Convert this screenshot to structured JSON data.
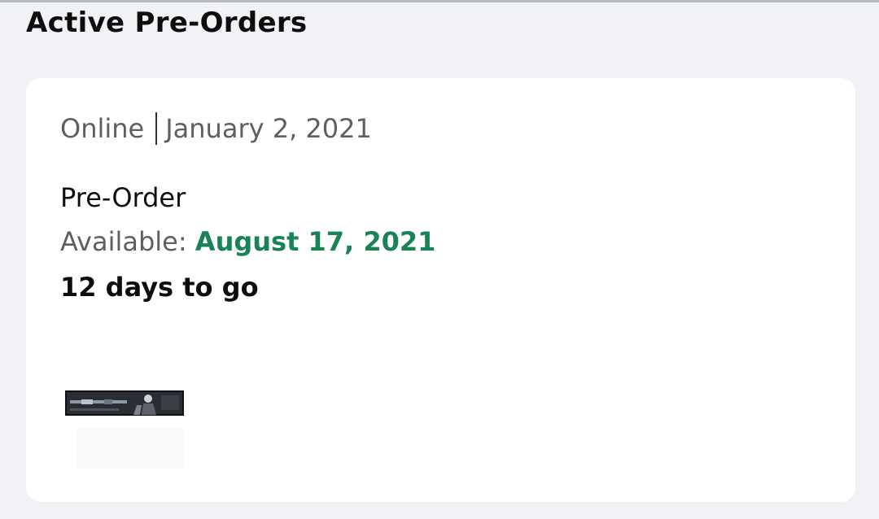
{
  "section": {
    "title": "Active Pre-Orders"
  },
  "order": {
    "channel": "Online",
    "order_date": "January 2, 2021",
    "type": "Pre-Order",
    "available_label": "Available: ",
    "available_date": "August 17, 2021",
    "countdown": "12 days to go"
  },
  "colors": {
    "background": "#f1f2f6",
    "card": "#ffffff",
    "accent_green": "#1a8356"
  },
  "icons": {
    "product": "product-box-thumbnail"
  }
}
